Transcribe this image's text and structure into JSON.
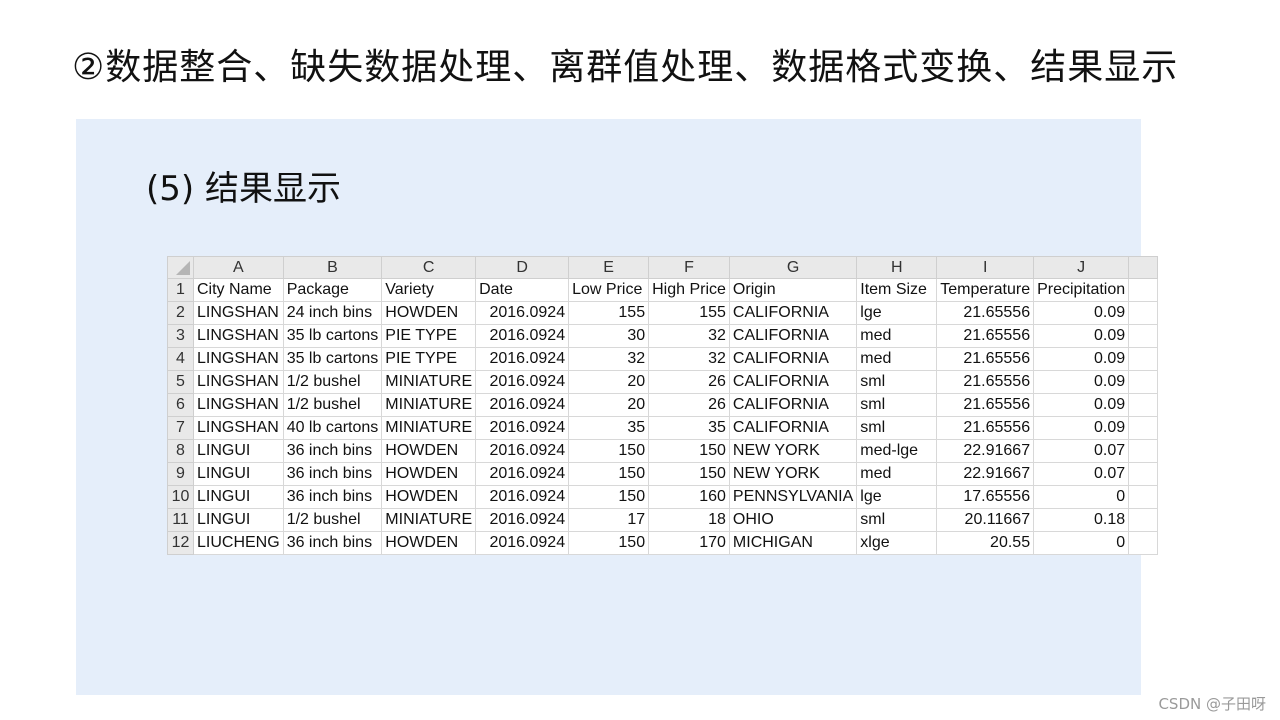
{
  "slide": {
    "title": "②数据整合、缺失数据处理、离群值处理、数据格式变换、结果显示",
    "subtitle": "(5) 结果显示"
  },
  "sheet": {
    "col_letters": [
      "A",
      "B",
      "C",
      "D",
      "E",
      "F",
      "G",
      "H",
      "I",
      "J"
    ],
    "row_numbers": [
      "1",
      "2",
      "3",
      "4",
      "5",
      "6",
      "7",
      "8",
      "9",
      "10",
      "11",
      "12"
    ],
    "headers": [
      "City Name",
      "Package",
      "Variety",
      "Date",
      "Low Price",
      "High Price",
      "Origin",
      "Item Size",
      "Temperature",
      "Precipitation"
    ],
    "rows": [
      [
        "LINGSHAN",
        "24 inch bins",
        "HOWDEN",
        "2016.0924",
        "155",
        "155",
        "CALIFORNIA",
        "lge",
        "21.65556",
        "0.09"
      ],
      [
        "LINGSHAN",
        "35 lb cartons",
        "PIE TYPE",
        "2016.0924",
        "30",
        "32",
        "CALIFORNIA",
        "med",
        "21.65556",
        "0.09"
      ],
      [
        "LINGSHAN",
        "35 lb cartons",
        "PIE TYPE",
        "2016.0924",
        "32",
        "32",
        "CALIFORNIA",
        "med",
        "21.65556",
        "0.09"
      ],
      [
        "LINGSHAN",
        "1/2 bushel",
        "MINIATURE",
        "2016.0924",
        "20",
        "26",
        "CALIFORNIA",
        "sml",
        "21.65556",
        "0.09"
      ],
      [
        "LINGSHAN",
        "1/2 bushel",
        "MINIATURE",
        "2016.0924",
        "20",
        "26",
        "CALIFORNIA",
        "sml",
        "21.65556",
        "0.09"
      ],
      [
        "LINGSHAN",
        "40 lb cartons",
        "MINIATURE",
        "2016.0924",
        "35",
        "35",
        "CALIFORNIA",
        "sml",
        "21.65556",
        "0.09"
      ],
      [
        "LINGUI",
        "36 inch bins",
        "HOWDEN",
        "2016.0924",
        "150",
        "150",
        "NEW YORK",
        "med-lge",
        "22.91667",
        "0.07"
      ],
      [
        "LINGUI",
        "36 inch bins",
        "HOWDEN",
        "2016.0924",
        "150",
        "150",
        "NEW YORK",
        "med",
        "22.91667",
        "0.07"
      ],
      [
        "LINGUI",
        "36 inch bins",
        "HOWDEN",
        "2016.0924",
        "150",
        "160",
        "PENNSYLVANIA",
        "lge",
        "17.65556",
        "0"
      ],
      [
        "LINGUI",
        "1/2 bushel",
        "MINIATURE",
        "2016.0924",
        "17",
        "18",
        "OHIO",
        "sml",
        "20.11667",
        "0.18"
      ],
      [
        "LIUCHENG",
        "36 inch bins",
        "HOWDEN",
        "2016.0924",
        "150",
        "170",
        "MICHIGAN",
        "xlge",
        "20.55",
        "0"
      ]
    ],
    "numeric_cols": [
      3,
      4,
      5,
      8,
      9
    ]
  },
  "watermark": "CSDN @子田呀"
}
